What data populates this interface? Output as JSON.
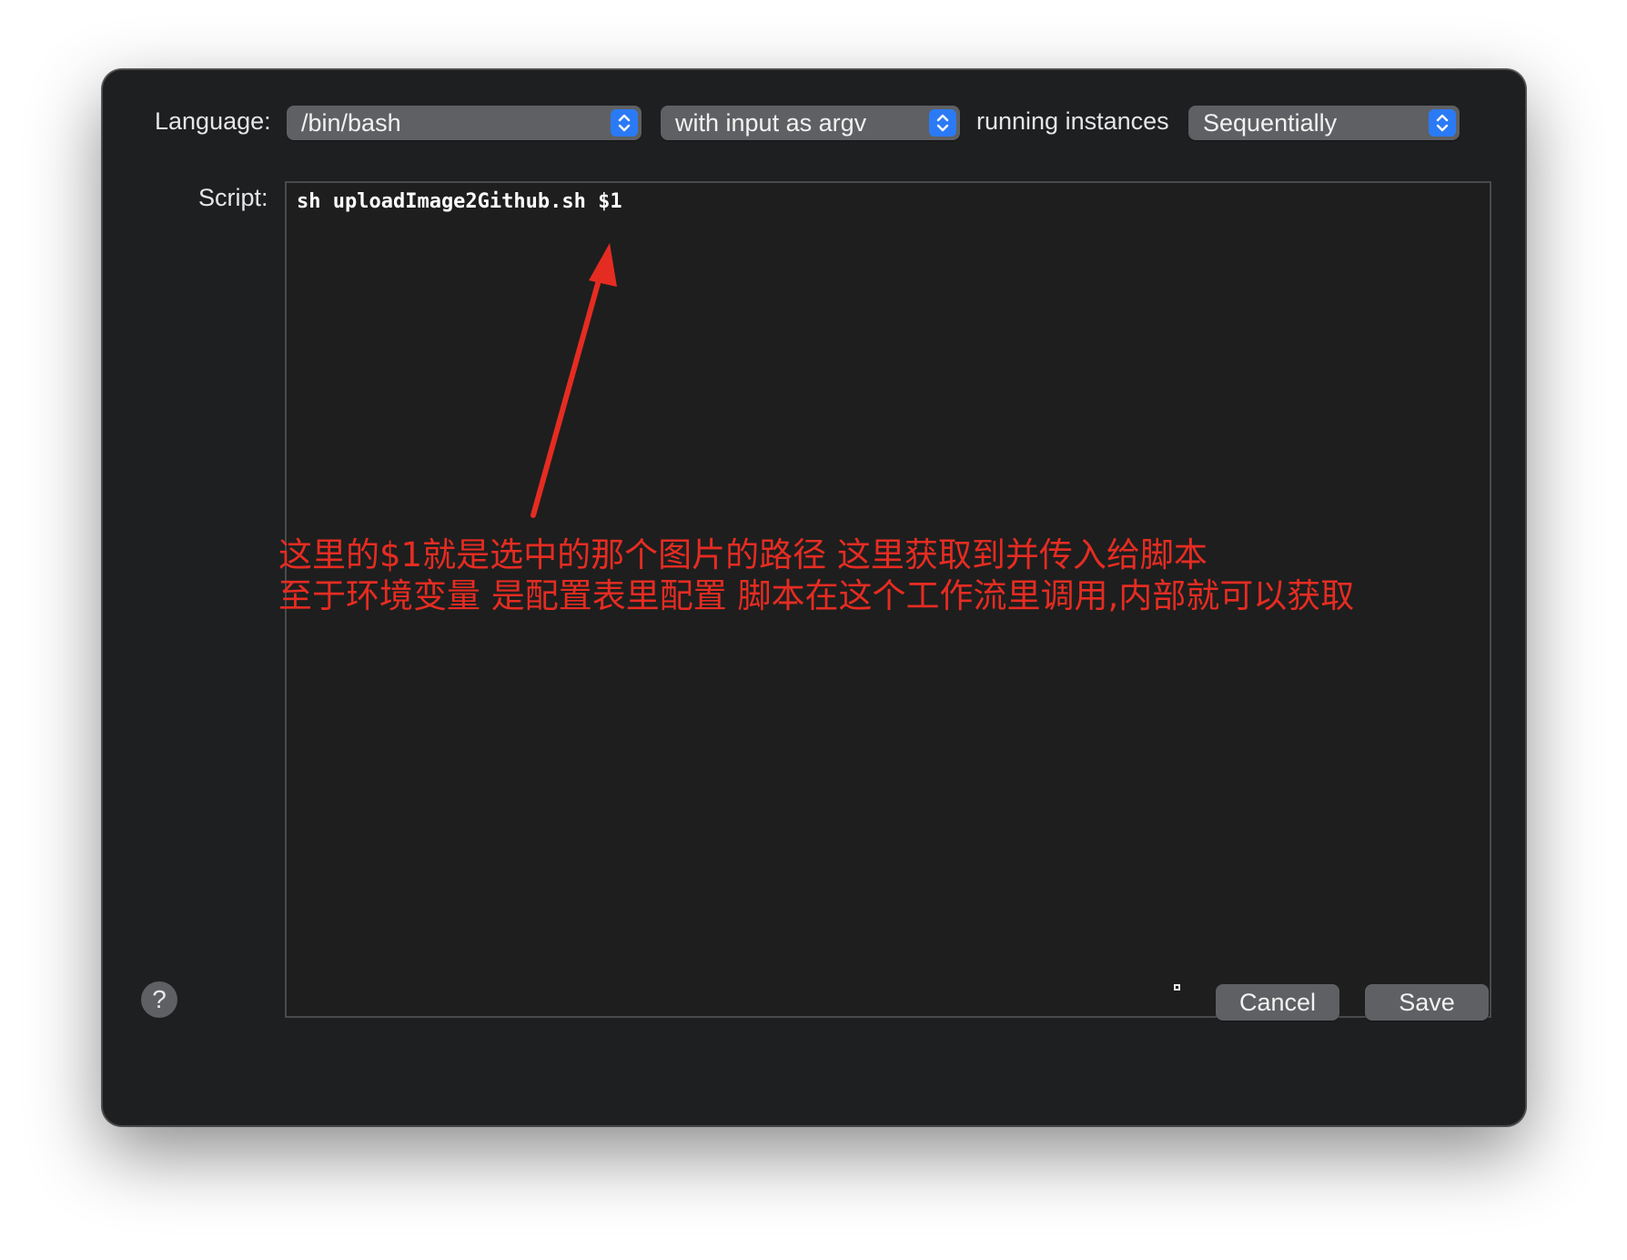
{
  "language": {
    "label": "Language:",
    "value": "/bin/bash"
  },
  "input_mode": {
    "value": "with input as argv"
  },
  "instances": {
    "label": "running instances",
    "value": "Sequentially"
  },
  "script": {
    "label": "Script:",
    "content": "sh uploadImage2Github.sh $1"
  },
  "annotation": {
    "line1": "这里的$1就是选中的那个图片的路径  这里获取到并传入给脚本",
    "line2": "至于环境变量 是配置表里配置 脚本在这个工作流里调用,内部就可以获取",
    "color": "#e52c22"
  },
  "footer": {
    "help_label": "?",
    "cancel_label": "Cancel",
    "save_label": "Save"
  },
  "icons": {
    "popup_stepper": "chevron-up-down-icon",
    "help": "help-icon",
    "arrow": "arrow-annotation-icon"
  },
  "colors": {
    "window_bg": "#1e1f21",
    "control_bg": "#5f6063",
    "accent": "#2b7af5"
  }
}
